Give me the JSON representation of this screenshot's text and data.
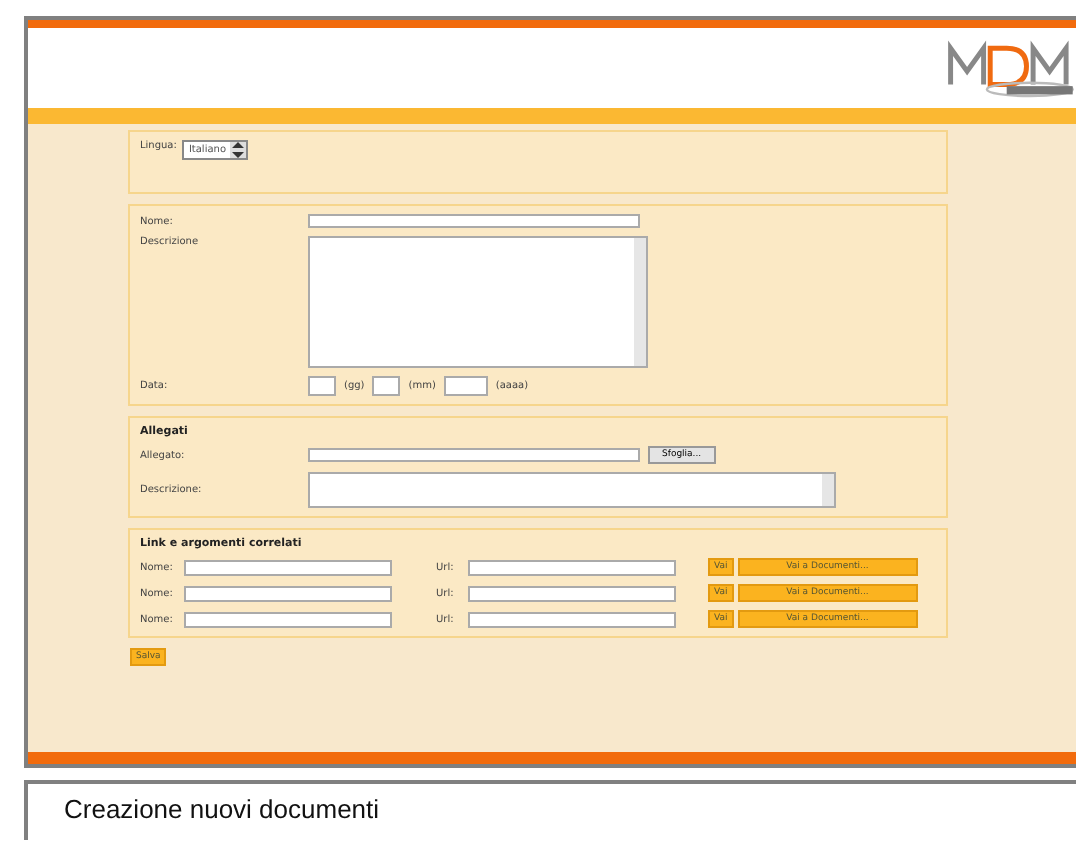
{
  "language": {
    "label": "Lingua:",
    "value": "Italiano"
  },
  "document": {
    "name_label": "Nome:",
    "description_label": "Descrizione",
    "date_label": "Data:",
    "day_unit": "(gg)",
    "month_unit": "(mm)",
    "year_unit": "(aaaa)"
  },
  "attachments": {
    "title": "Allegati",
    "file_label": "Allegato:",
    "browse_button": "Sfoglia...",
    "description_label": "Descrizione:"
  },
  "links": {
    "title": "Link e argomenti correlati",
    "rows": [
      {
        "name_label": "Nome:",
        "url_label": "Url:",
        "go_button": "Vai",
        "documents_button": "Vai a Documenti..."
      },
      {
        "name_label": "Nome:",
        "url_label": "Url:",
        "go_button": "Vai",
        "documents_button": "Vai a Documenti..."
      },
      {
        "name_label": "Nome:",
        "url_label": "Url:",
        "go_button": "Vai",
        "documents_button": "Vai a Documenti..."
      }
    ]
  },
  "save_button": "Salva",
  "caption": "Creazione nuovi documenti"
}
